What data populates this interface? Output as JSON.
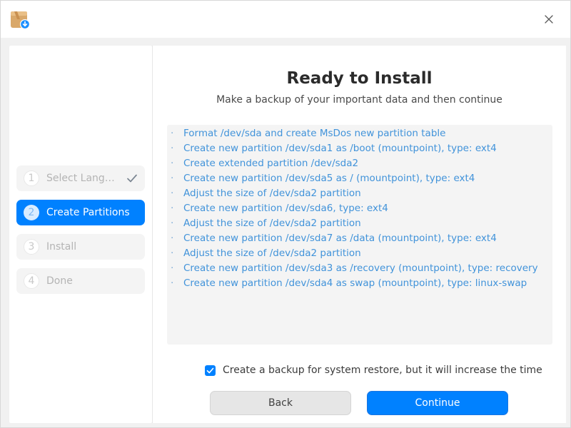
{
  "window": {
    "app_icon": "installer-package-icon",
    "close_icon": "close-icon"
  },
  "sidebar": {
    "steps": [
      {
        "number": "1",
        "label": "Select Langu…",
        "state": "done"
      },
      {
        "number": "2",
        "label": "Create Partitions",
        "state": "active"
      },
      {
        "number": "3",
        "label": "Install",
        "state": "pending"
      },
      {
        "number": "4",
        "label": "Done",
        "state": "pending"
      }
    ]
  },
  "main": {
    "title": "Ready to Install",
    "subtitle": "Make a backup of your important data and then continue",
    "bullet": "·",
    "operations": [
      "Format /dev/sda and create MsDos new partition table",
      "Create new partition /dev/sda1 as /boot (mountpoint), type: ext4",
      "Create extended partition /dev/sda2",
      "Create new partition /dev/sda5 as / (mountpoint), type: ext4",
      "Adjust the size of /dev/sda2 partition",
      "Create new partition /dev/sda6, type: ext4",
      "Adjust the size of /dev/sda2 partition",
      "Create new partition /dev/sda7 as /data (mountpoint), type: ext4",
      "Adjust the size of /dev/sda2 partition",
      "Create new partition /dev/sda3 as /recovery (mountpoint), type: recovery",
      "Create new partition /dev/sda4 as swap (mountpoint), type: linux-swap"
    ],
    "backup_checkbox": {
      "label": "Create a backup for system restore, but it will increase the time",
      "checked": true
    },
    "back_label": "Back",
    "continue_label": "Continue"
  },
  "colors": {
    "accent": "#0081ff",
    "operation_text": "#4193da"
  }
}
